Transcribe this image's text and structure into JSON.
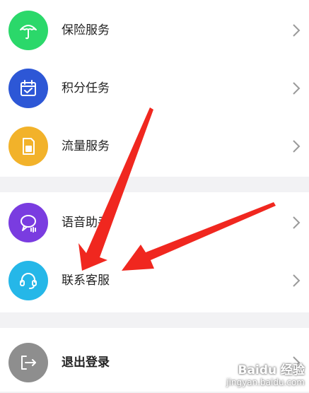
{
  "menu_groups": [
    [
      {
        "label": "保险服务",
        "icon": "umbrella-icon",
        "color": "#2bd86a"
      },
      {
        "label": "积分任务",
        "icon": "calendar-check-icon",
        "color": "#2d57d6"
      },
      {
        "label": "流量服务",
        "icon": "sim-card-icon",
        "color": "#f2b22a"
      }
    ],
    [
      {
        "label": "语音助手",
        "icon": "voice-chat-icon",
        "color": "#7a3ce0"
      },
      {
        "label": "联系客服",
        "icon": "headset-icon",
        "color": "#25b7e8"
      }
    ],
    [
      {
        "label": "退出登录",
        "icon": "logout-icon",
        "color": "#8e8e8e"
      }
    ]
  ],
  "annotation": {
    "arrow_color": "#f0271f"
  },
  "watermark": {
    "main": "Baidu 经验",
    "sub": "jingyan.baidu.com"
  }
}
